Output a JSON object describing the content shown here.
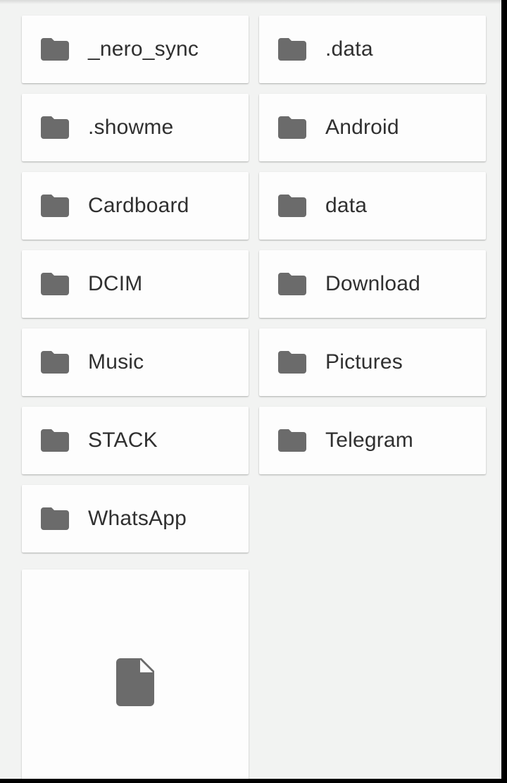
{
  "colors": {
    "background": "#f2f3f2",
    "card": "#fdfdfd",
    "icon": "#6b6b6b",
    "text": "#303030"
  },
  "folders": [
    {
      "name": "_nero_sync",
      "icon": "folder-icon"
    },
    {
      "name": ".data",
      "icon": "folder-icon"
    },
    {
      "name": ".showme",
      "icon": "folder-icon"
    },
    {
      "name": "Android",
      "icon": "folder-icon"
    },
    {
      "name": "Cardboard",
      "icon": "folder-icon"
    },
    {
      "name": "data",
      "icon": "folder-icon"
    },
    {
      "name": "DCIM",
      "icon": "folder-icon"
    },
    {
      "name": "Download",
      "icon": "folder-icon"
    },
    {
      "name": "Music",
      "icon": "folder-icon"
    },
    {
      "name": "Pictures",
      "icon": "folder-icon"
    },
    {
      "name": "STACK",
      "icon": "folder-icon"
    },
    {
      "name": "Telegram",
      "icon": "folder-icon"
    },
    {
      "name": "WhatsApp",
      "icon": "folder-icon"
    }
  ],
  "files": [
    {
      "icon": "file-icon"
    }
  ]
}
